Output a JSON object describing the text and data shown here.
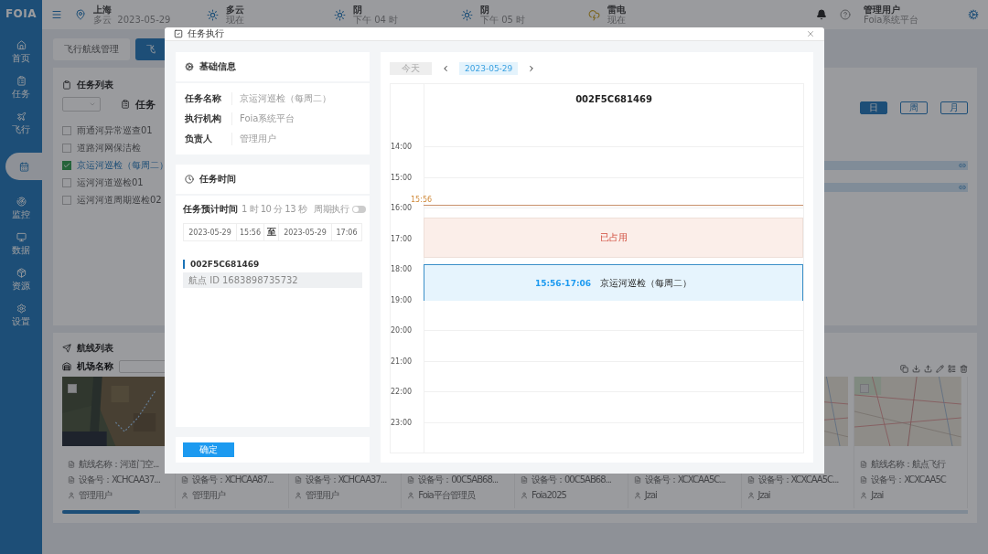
{
  "sidebar": {
    "logo": "FOIA",
    "items": [
      {
        "label": "首页",
        "selected": false
      },
      {
        "label": "任务",
        "selected": false
      },
      {
        "label": "飞行",
        "selected": false
      },
      {
        "selected": true
      },
      {
        "label": "监控",
        "selected": false
      },
      {
        "label": "数据",
        "selected": false
      },
      {
        "label": "资源",
        "selected": false
      },
      {
        "label": "设置",
        "selected": false
      }
    ]
  },
  "topbar": {
    "location": {
      "city": "上海",
      "weather": "多云",
      "date": "2023-05-29"
    },
    "forecast": [
      {
        "condition": "多云",
        "time": "现在",
        "kind": "sun"
      },
      {
        "condition": "阴",
        "time": "下午 04 时",
        "kind": "sun"
      },
      {
        "condition": "阴",
        "time": "下午 05 时",
        "kind": "sun"
      },
      {
        "condition": "雷电",
        "time": "现在",
        "kind": "storm"
      }
    ],
    "user": {
      "name": "管理用户",
      "org": "Foia系统平台"
    }
  },
  "page_tabs": [
    {
      "label": "飞行航线管理",
      "selected": false
    },
    {
      "label": "飞",
      "selected": true
    }
  ],
  "task_list": {
    "title": "任务列表",
    "column_title": "任务",
    "items": [
      {
        "label": "雨通河异常巡查01",
        "checked": false
      },
      {
        "label": "道路河网保洁检",
        "checked": false
      },
      {
        "label": "京运河巡检（每周二）",
        "checked": true
      },
      {
        "label": "运河河道巡检01",
        "checked": false
      },
      {
        "label": "运河河道周期巡检02",
        "checked": false
      }
    ]
  },
  "views": [
    {
      "label": "日",
      "selected": true
    },
    {
      "label": "周",
      "selected": false
    },
    {
      "label": "月",
      "selected": false
    }
  ],
  "route_list": {
    "title": "航线列表",
    "filter_label": "机场名称",
    "cards": [
      {
        "name": "航线名称：河道门空...",
        "device": "设备号：XCHCAA37...",
        "owner": "管理用户",
        "checked": false
      },
      {
        "device": "设备号：XCHCAA87...",
        "owner": "管理用户"
      },
      {
        "device": "设备号：XCHCAA37...",
        "owner": "管理用户"
      },
      {
        "device": "设备号：00C5AB68...",
        "owner": "Foia平台管理员"
      },
      {
        "device": "设备号：00C5AB68...",
        "owner": "Foia2025"
      },
      {
        "device": "设备号：XCXCAA5C...",
        "owner": "Jzai"
      },
      {
        "device": "设备号：XCXCAA5C...",
        "owner": "Jzai"
      },
      {
        "name": "航线名称：航点飞行",
        "device": "设备号：XCXCAA5C",
        "owner": "Jzai",
        "checked": false
      }
    ]
  },
  "dialog": {
    "title": "任务执行",
    "basic": {
      "title": "基础信息",
      "fields": [
        {
          "label": "任务名称",
          "value": "京运河巡检（每周二）"
        },
        {
          "label": "执行机构",
          "value": "Foia系统平台"
        },
        {
          "label": "负责人",
          "value": "管理用户"
        }
      ]
    },
    "time": {
      "title": "任务时间",
      "estimate_label": "任务预计时间",
      "estimate": "1 时 10 分 13 秒",
      "repeat_label": "周期执行",
      "repeat_on": false,
      "start_date": "2023-05-29",
      "start_time": "15:56",
      "separator": "至",
      "end_date": "2023-05-29",
      "end_time": "17:06"
    },
    "device": {
      "id": "002F5C681469",
      "waypoint": "航点 ID 1683898735732"
    },
    "confirm": "确定",
    "schedule": {
      "today": "今天",
      "date": "2023-05-29",
      "column": "002F5C681469",
      "hours": [
        "14:00",
        "15:00",
        "16:00",
        "17:00",
        "18:00",
        "19:00",
        "20:00",
        "21:00",
        "22:00",
        "23:00"
      ],
      "now": "15:56",
      "occupied": "已占用",
      "event": {
        "time": "15:56-17:06",
        "title": "京运河巡检（每周二）"
      }
    }
  }
}
